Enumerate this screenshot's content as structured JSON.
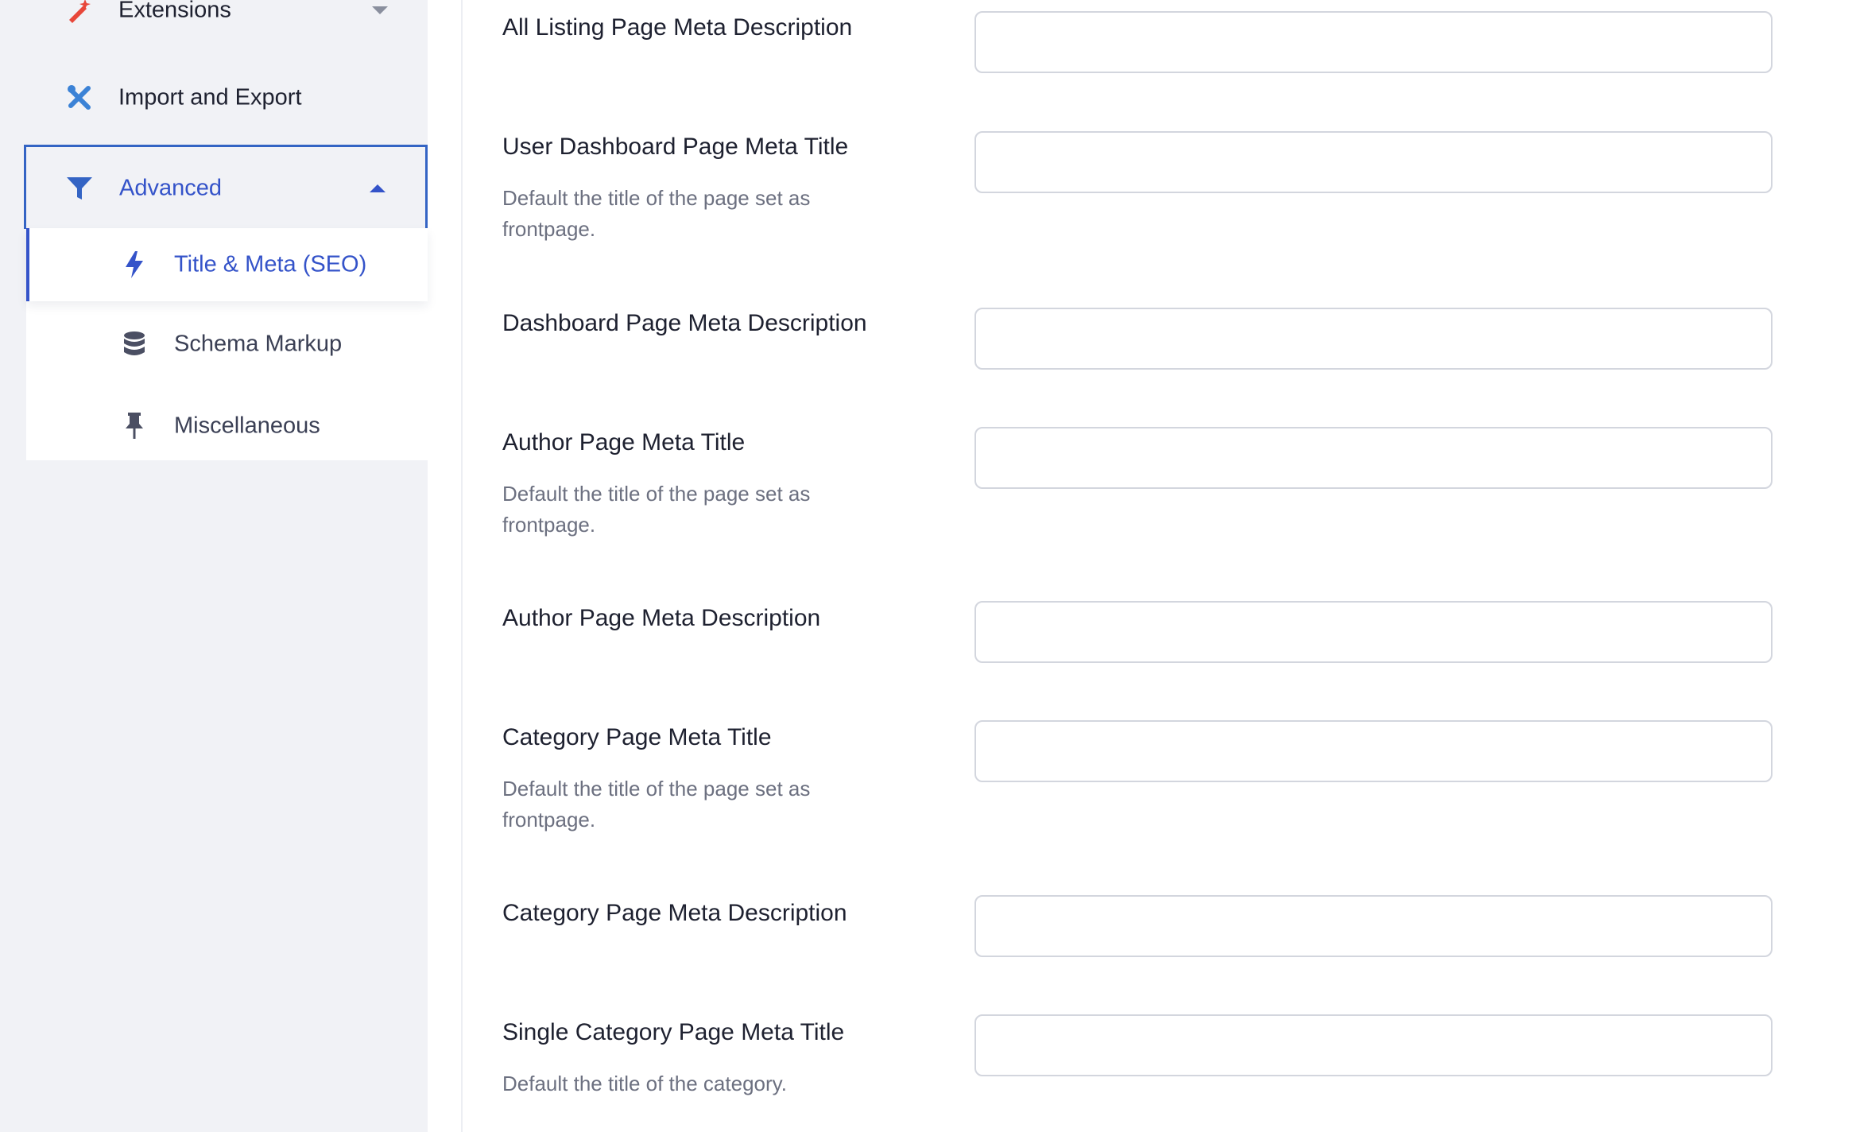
{
  "sidebar": {
    "items": [
      {
        "label": "Extensions",
        "icon": "magic-wand-icon"
      },
      {
        "label": "Import and Export",
        "icon": "tools-icon"
      },
      {
        "label": "Advanced",
        "icon": "filter-icon"
      }
    ],
    "submenu": [
      {
        "label": "Title & Meta (SEO)",
        "icon": "bolt-icon"
      },
      {
        "label": "Schema Markup",
        "icon": "database-icon"
      },
      {
        "label": "Miscellaneous",
        "icon": "pin-icon"
      }
    ]
  },
  "colors": {
    "accent": "#3453c9",
    "extensions_icon": "#e8473a",
    "import_icon": "#3b82d6"
  },
  "fields": [
    {
      "label": "All Listing Page Meta Description",
      "value": ""
    },
    {
      "label": "User Dashboard Page Meta Title",
      "description": "Default the title of the page set as frontpage.",
      "value": ""
    },
    {
      "label": "Dashboard Page Meta Description",
      "value": ""
    },
    {
      "label": "Author Page Meta Title",
      "description": "Default the title of the page set as frontpage.",
      "value": ""
    },
    {
      "label": "Author Page Meta Description",
      "value": ""
    },
    {
      "label": "Category Page Meta Title",
      "description": "Default the title of the page set as frontpage.",
      "value": ""
    },
    {
      "label": "Category Page Meta Description",
      "value": ""
    },
    {
      "label": "Single Category Page Meta Title",
      "description": "Default the title of the category.",
      "value": ""
    }
  ]
}
